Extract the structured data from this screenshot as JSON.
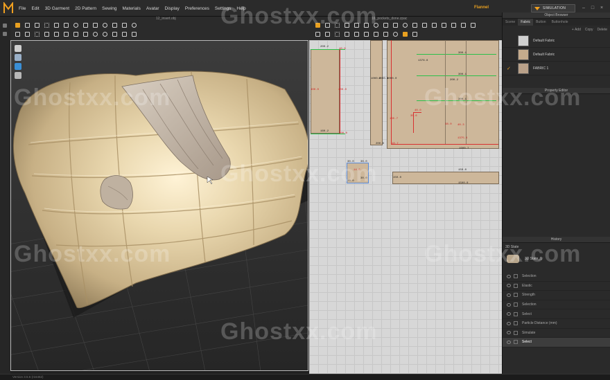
{
  "menu": {
    "items": [
      "File",
      "Edit",
      "3D Garment",
      "2D Pattern",
      "Sewing",
      "Materials",
      "Avatar",
      "Display",
      "Preferences",
      "Settings",
      "Help"
    ],
    "user": "Flannel",
    "simulation_label": "SIMULATION"
  },
  "tabs": {
    "view3d_title": "12_insert.obj",
    "view2d_title": "16_pockets_done.zpac"
  },
  "pattern_dims": {
    "a1": "200.2",
    "a2": "40.0",
    "a3": "400.0",
    "a4": "400.0",
    "a5": "160.2",
    "a6": "200.0",
    "b1": "1000.0",
    "b2": "1000.0",
    "b3": "1000.0",
    "b4": "200.0",
    "c1": "300.1",
    "c2": "300.1",
    "c3": "300.1",
    "c4": "200.2",
    "c5": "1376.8",
    "c6": "1600.7",
    "c7": "40.0",
    "c8": "35.6",
    "c9": "135.7",
    "c10": "38.0",
    "c11": "40.3",
    "c12": "10.7",
    "c13": "1375.4",
    "d1": "30.0",
    "d2": "30.0",
    "d3": "14.0",
    "d4": "30.0",
    "d5": "20.0",
    "e1": "150.0",
    "e2": "150.0",
    "e3": "1500.0"
  },
  "object_browser": {
    "title": "Object Browser",
    "tabs": [
      "Scene",
      "Fabric",
      "Button",
      "Buttonhole"
    ],
    "active_tab": "Fabric",
    "actions": [
      "+ Add",
      "Copy",
      "Delete"
    ],
    "fabrics": [
      {
        "name": "Default Fabric",
        "color": "#cfcfcf",
        "checked": false
      },
      {
        "name": "Default Fabric",
        "color": "#c4ab8c",
        "checked": false
      },
      {
        "name": "FABRIC 1",
        "color": "#b9a189",
        "checked": true
      }
    ]
  },
  "property_editor": {
    "title": "Property Editor"
  },
  "history": {
    "title": "History",
    "state_label": "3D State",
    "state_name": "3D State_1",
    "items": [
      {
        "label": "Selection",
        "selected": false
      },
      {
        "label": "Elastic",
        "selected": false
      },
      {
        "label": "Strength",
        "selected": false
      },
      {
        "label": "Selection",
        "selected": false
      },
      {
        "label": "Select",
        "selected": false
      },
      {
        "label": "Particle Distance (mm)",
        "selected": false
      },
      {
        "label": "Simulate",
        "selected": false
      },
      {
        "label": "Select",
        "selected": true
      }
    ]
  },
  "status": {
    "text": "Version 3.5.6 (r16462)"
  },
  "watermark": "Ghostxx.com"
}
